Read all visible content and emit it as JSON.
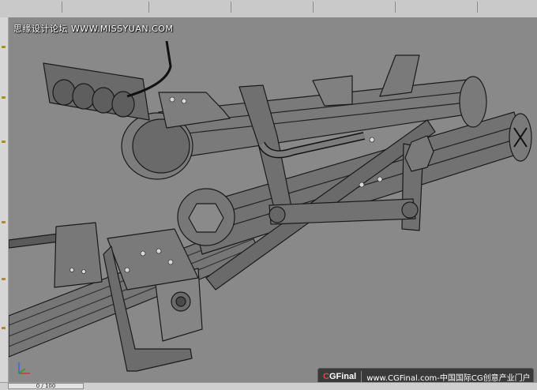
{
  "watermark": {
    "text": "思缘设计论坛 WWW.MISSYUAN.COM"
  },
  "timeline": {
    "frame_label": "0 / 100"
  },
  "brand": {
    "logo_prefix": "C",
    "logo_rest": "GFinal",
    "tagline": "www.CGFinal.com-中国国际CG创意产业门户"
  },
  "icons": [
    "axis-gizmo-icon"
  ],
  "colors": {
    "viewport_bg": "#898989",
    "model_fill": "#6e6e6e",
    "model_edge": "#1a1a1a",
    "brand_bar": "#3a3a3a"
  }
}
